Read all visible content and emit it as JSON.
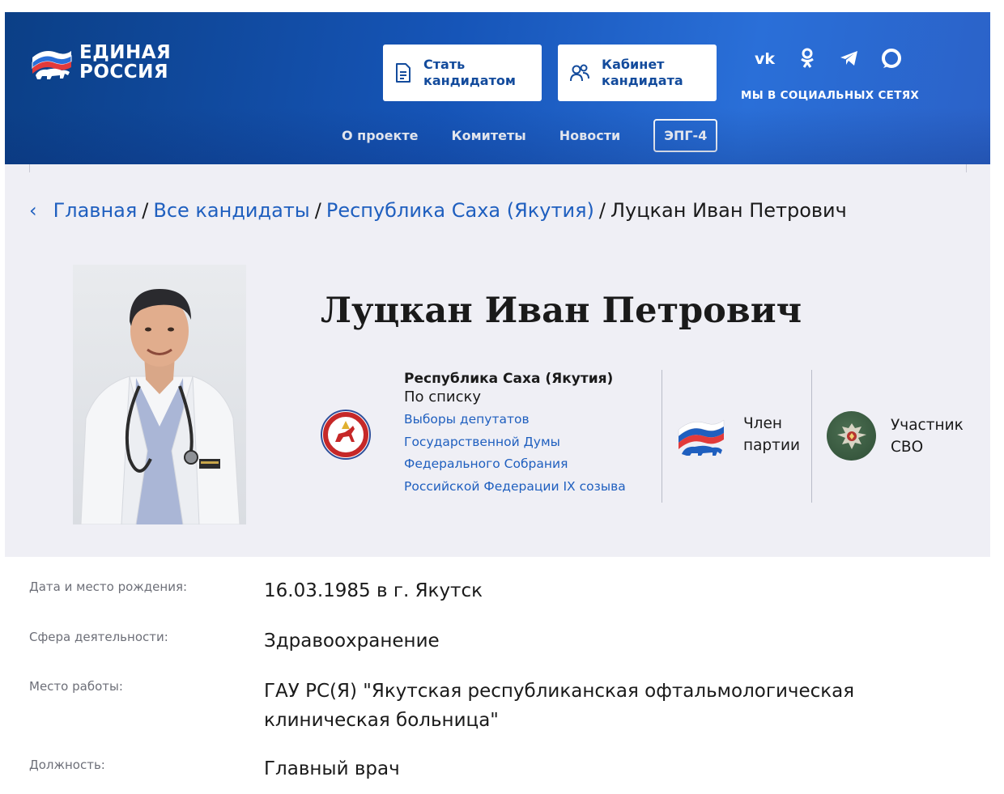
{
  "header": {
    "logo_text_line1": "ЕДИНАЯ",
    "logo_text_line2": "РОССИЯ",
    "buttons": [
      {
        "label": "Стать\nкандидатом",
        "icon": "document-icon"
      },
      {
        "label": "Кабинет\nкандидата",
        "icon": "users-icon"
      }
    ],
    "socials": [
      {
        "name": "vk-icon",
        "glyph": "vk"
      },
      {
        "name": "ok-icon",
        "glyph": "ok"
      },
      {
        "name": "telegram-icon",
        "glyph": "telegram"
      },
      {
        "name": "max-icon",
        "glyph": "max"
      }
    ],
    "socials_label": "МЫ В СОЦИАЛЬНЫХ СЕТЯХ",
    "nav": [
      {
        "label": "О проекте"
      },
      {
        "label": "Комитеты"
      },
      {
        "label": "Новости"
      }
    ],
    "nav_epg": "ЭПГ-4",
    "accent_color": "#1655b8"
  },
  "breadcrumb": {
    "items": [
      "Главная",
      "Все кандидаты",
      "Республика Саха (Якутия)"
    ],
    "separator": "/",
    "current": "Луцкан Иван Петрович"
  },
  "profile": {
    "name": "Луцкан Иван Петрович",
    "region": "Республика Саха (Якутия)",
    "list_type": "По списку",
    "election_lines": [
      "Выборы депутатов",
      "Государственной Думы",
      "Федерального Собрания",
      "Российской Федерации IX созыва"
    ],
    "party_badge": "Член\nпартии",
    "svo_badge": "Участник\nСВО",
    "link_color": "#1f5fbf"
  },
  "details": [
    {
      "label": "Дата и место рождения:",
      "value": "16.03.1985 в г. Якутск"
    },
    {
      "label": "Сфера деятельности:",
      "value": "Здравоохранение"
    },
    {
      "label": "Место работы:",
      "value": "ГАУ РС(Я) \"Якутская республиканская офтальмологическая клиническая больница\""
    },
    {
      "label": "Должность:",
      "value": "Главный врач"
    }
  ]
}
